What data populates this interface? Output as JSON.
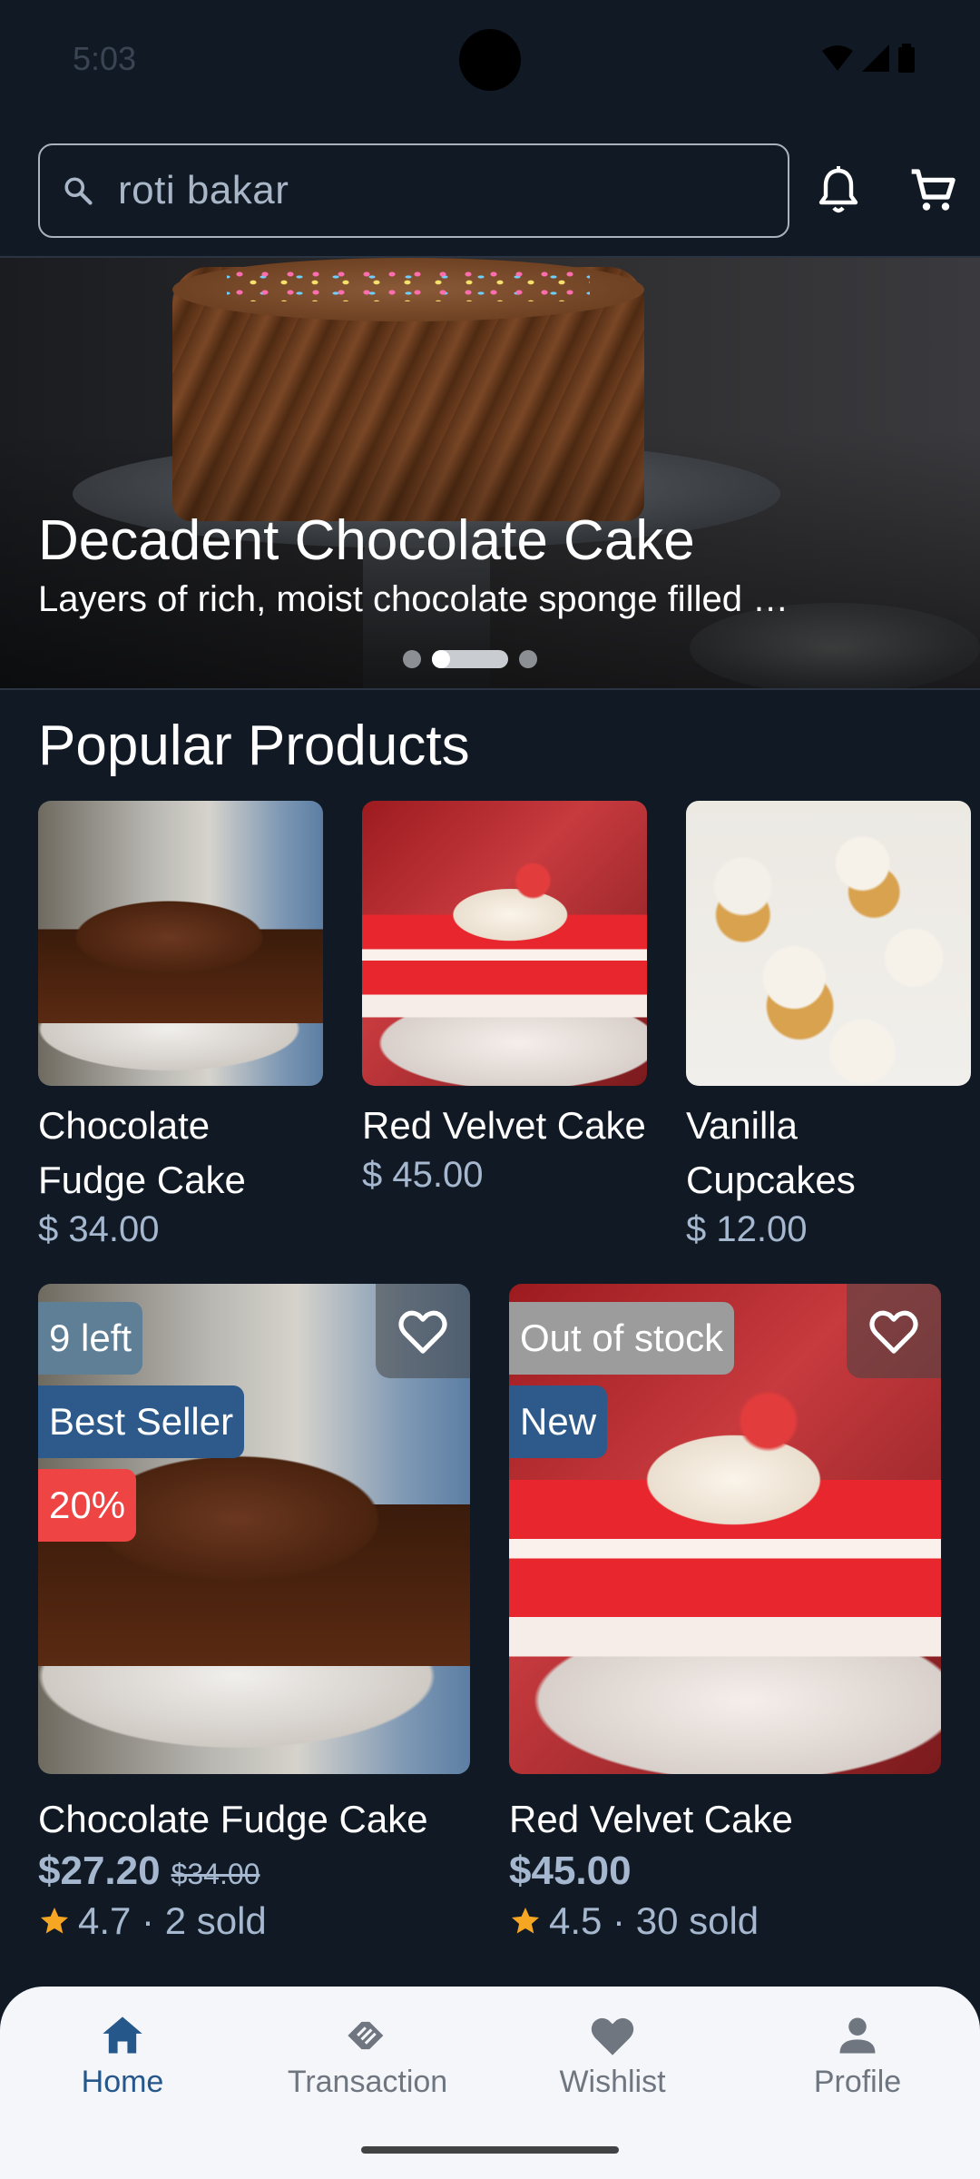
{
  "status_bar": {
    "time": "5:03"
  },
  "search": {
    "value": "roti bakar"
  },
  "hero": {
    "title": "Decadent Chocolate Cake",
    "subtitle": "Layers of rich, moist chocolate sponge filled …",
    "active_slide_index": 1,
    "slide_count": 3
  },
  "popular": {
    "title": "Popular Products",
    "items": [
      {
        "name": "Chocolate Fudge Cake",
        "price": "$ 34.00"
      },
      {
        "name": "Red Velvet Cake",
        "price": "$ 45.00"
      },
      {
        "name": "Vanilla Cupcakes",
        "price": "$ 12.00"
      }
    ]
  },
  "products": [
    {
      "name": "Chocolate Fudge Cake",
      "price": "$27.20",
      "old_price": "$34.00",
      "rating_text": "4.7 · 2 sold",
      "badges": [
        {
          "text": "9 left",
          "color": "#5e7f96"
        },
        {
          "text": "Best Seller",
          "color": "#2d5a8a"
        },
        {
          "text": "20%",
          "color": "#ef4444"
        }
      ]
    },
    {
      "name": "Red Velvet Cake",
      "price": "$45.00",
      "old_price": "",
      "rating_text": "4.5 · 30 sold",
      "badges": [
        {
          "text": "Out of stock",
          "color": "#9c9c9c"
        },
        {
          "text": "New",
          "color": "#2d5a8a"
        }
      ]
    }
  ],
  "nav": {
    "items": [
      {
        "label": "Home",
        "icon": "home-icon",
        "active": true
      },
      {
        "label": "Transaction",
        "icon": "transaction-icon",
        "active": false
      },
      {
        "label": "Wishlist",
        "icon": "heart-icon",
        "active": false
      },
      {
        "label": "Profile",
        "icon": "person-icon",
        "active": false
      }
    ]
  },
  "colors": {
    "background": "#111a24",
    "accent": "#25578b",
    "price": "#a6b8cf",
    "star": "#f5a623"
  }
}
